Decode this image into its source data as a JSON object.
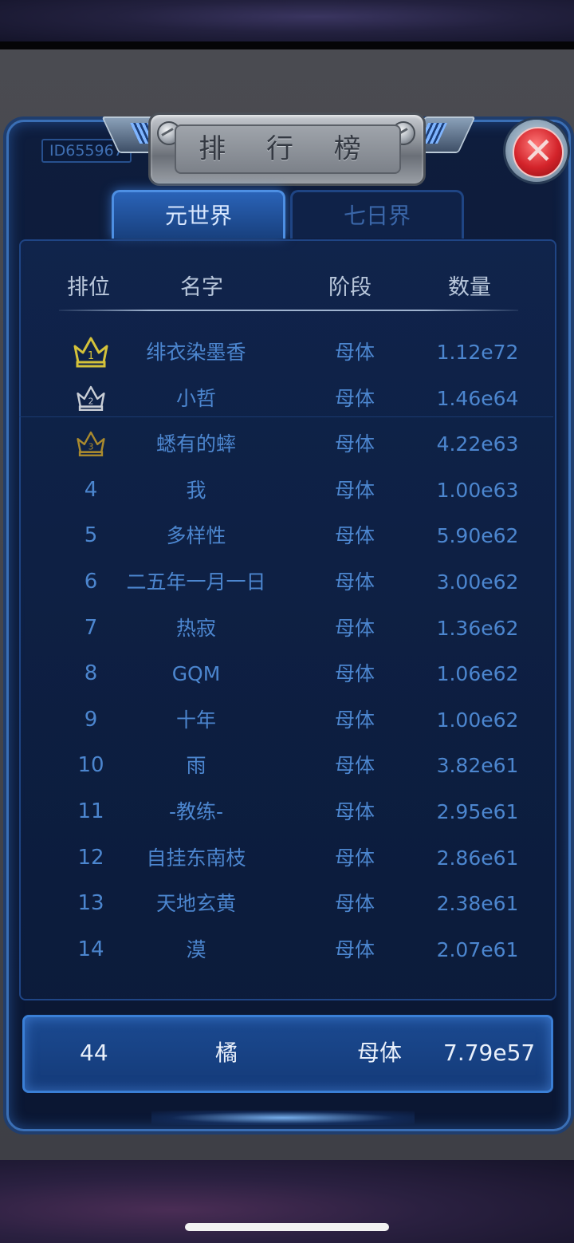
{
  "player_id": "ID655967",
  "title": "排 行 榜",
  "tabs": {
    "active": "元世界",
    "inactive": "七日界"
  },
  "headers": {
    "rank": "排位",
    "name": "名字",
    "stage": "阶段",
    "count": "数量"
  },
  "rows": [
    {
      "rank": "1",
      "name": "绯衣染墨香",
      "stage": "母体",
      "count": "1.12e72",
      "crown": "gold"
    },
    {
      "rank": "2",
      "name": "小哲",
      "stage": "母体",
      "count": "1.46e64",
      "crown": "silver"
    },
    {
      "rank": "3",
      "name": "蟋有的蟀",
      "stage": "母体",
      "count": "4.22e63",
      "crown": "bronze"
    },
    {
      "rank": "4",
      "name": "我",
      "stage": "母体",
      "count": "1.00e63"
    },
    {
      "rank": "5",
      "name": "多样性",
      "stage": "母体",
      "count": "5.90e62"
    },
    {
      "rank": "6",
      "name": "二五年一月一日",
      "stage": "母体",
      "count": "3.00e62"
    },
    {
      "rank": "7",
      "name": "热寂",
      "stage": "母体",
      "count": "1.36e62"
    },
    {
      "rank": "8",
      "name": "GQM",
      "stage": "母体",
      "count": "1.06e62"
    },
    {
      "rank": "9",
      "name": "十年",
      "stage": "母体",
      "count": "1.00e62"
    },
    {
      "rank": "10",
      "name": "雨",
      "stage": "母体",
      "count": "3.82e61"
    },
    {
      "rank": "11",
      "name": "-教练-",
      "stage": "母体",
      "count": "2.95e61"
    },
    {
      "rank": "12",
      "name": "自挂东南枝",
      "stage": "母体",
      "count": "2.86e61"
    },
    {
      "rank": "13",
      "name": "天地玄黄",
      "stage": "母体",
      "count": "2.38e61"
    },
    {
      "rank": "14",
      "name": "漠",
      "stage": "母体",
      "count": "2.07e61"
    }
  ],
  "self": {
    "rank": "44",
    "name": "橘",
    "stage": "母体",
    "count": "7.79e57"
  },
  "colors": {
    "gold": "#d4c23a",
    "silver": "#c9ced6",
    "bronze": "#a98a2e",
    "accent": "#4c86cf"
  },
  "icons": {
    "close": "close-icon",
    "crown": "crown-icon"
  }
}
